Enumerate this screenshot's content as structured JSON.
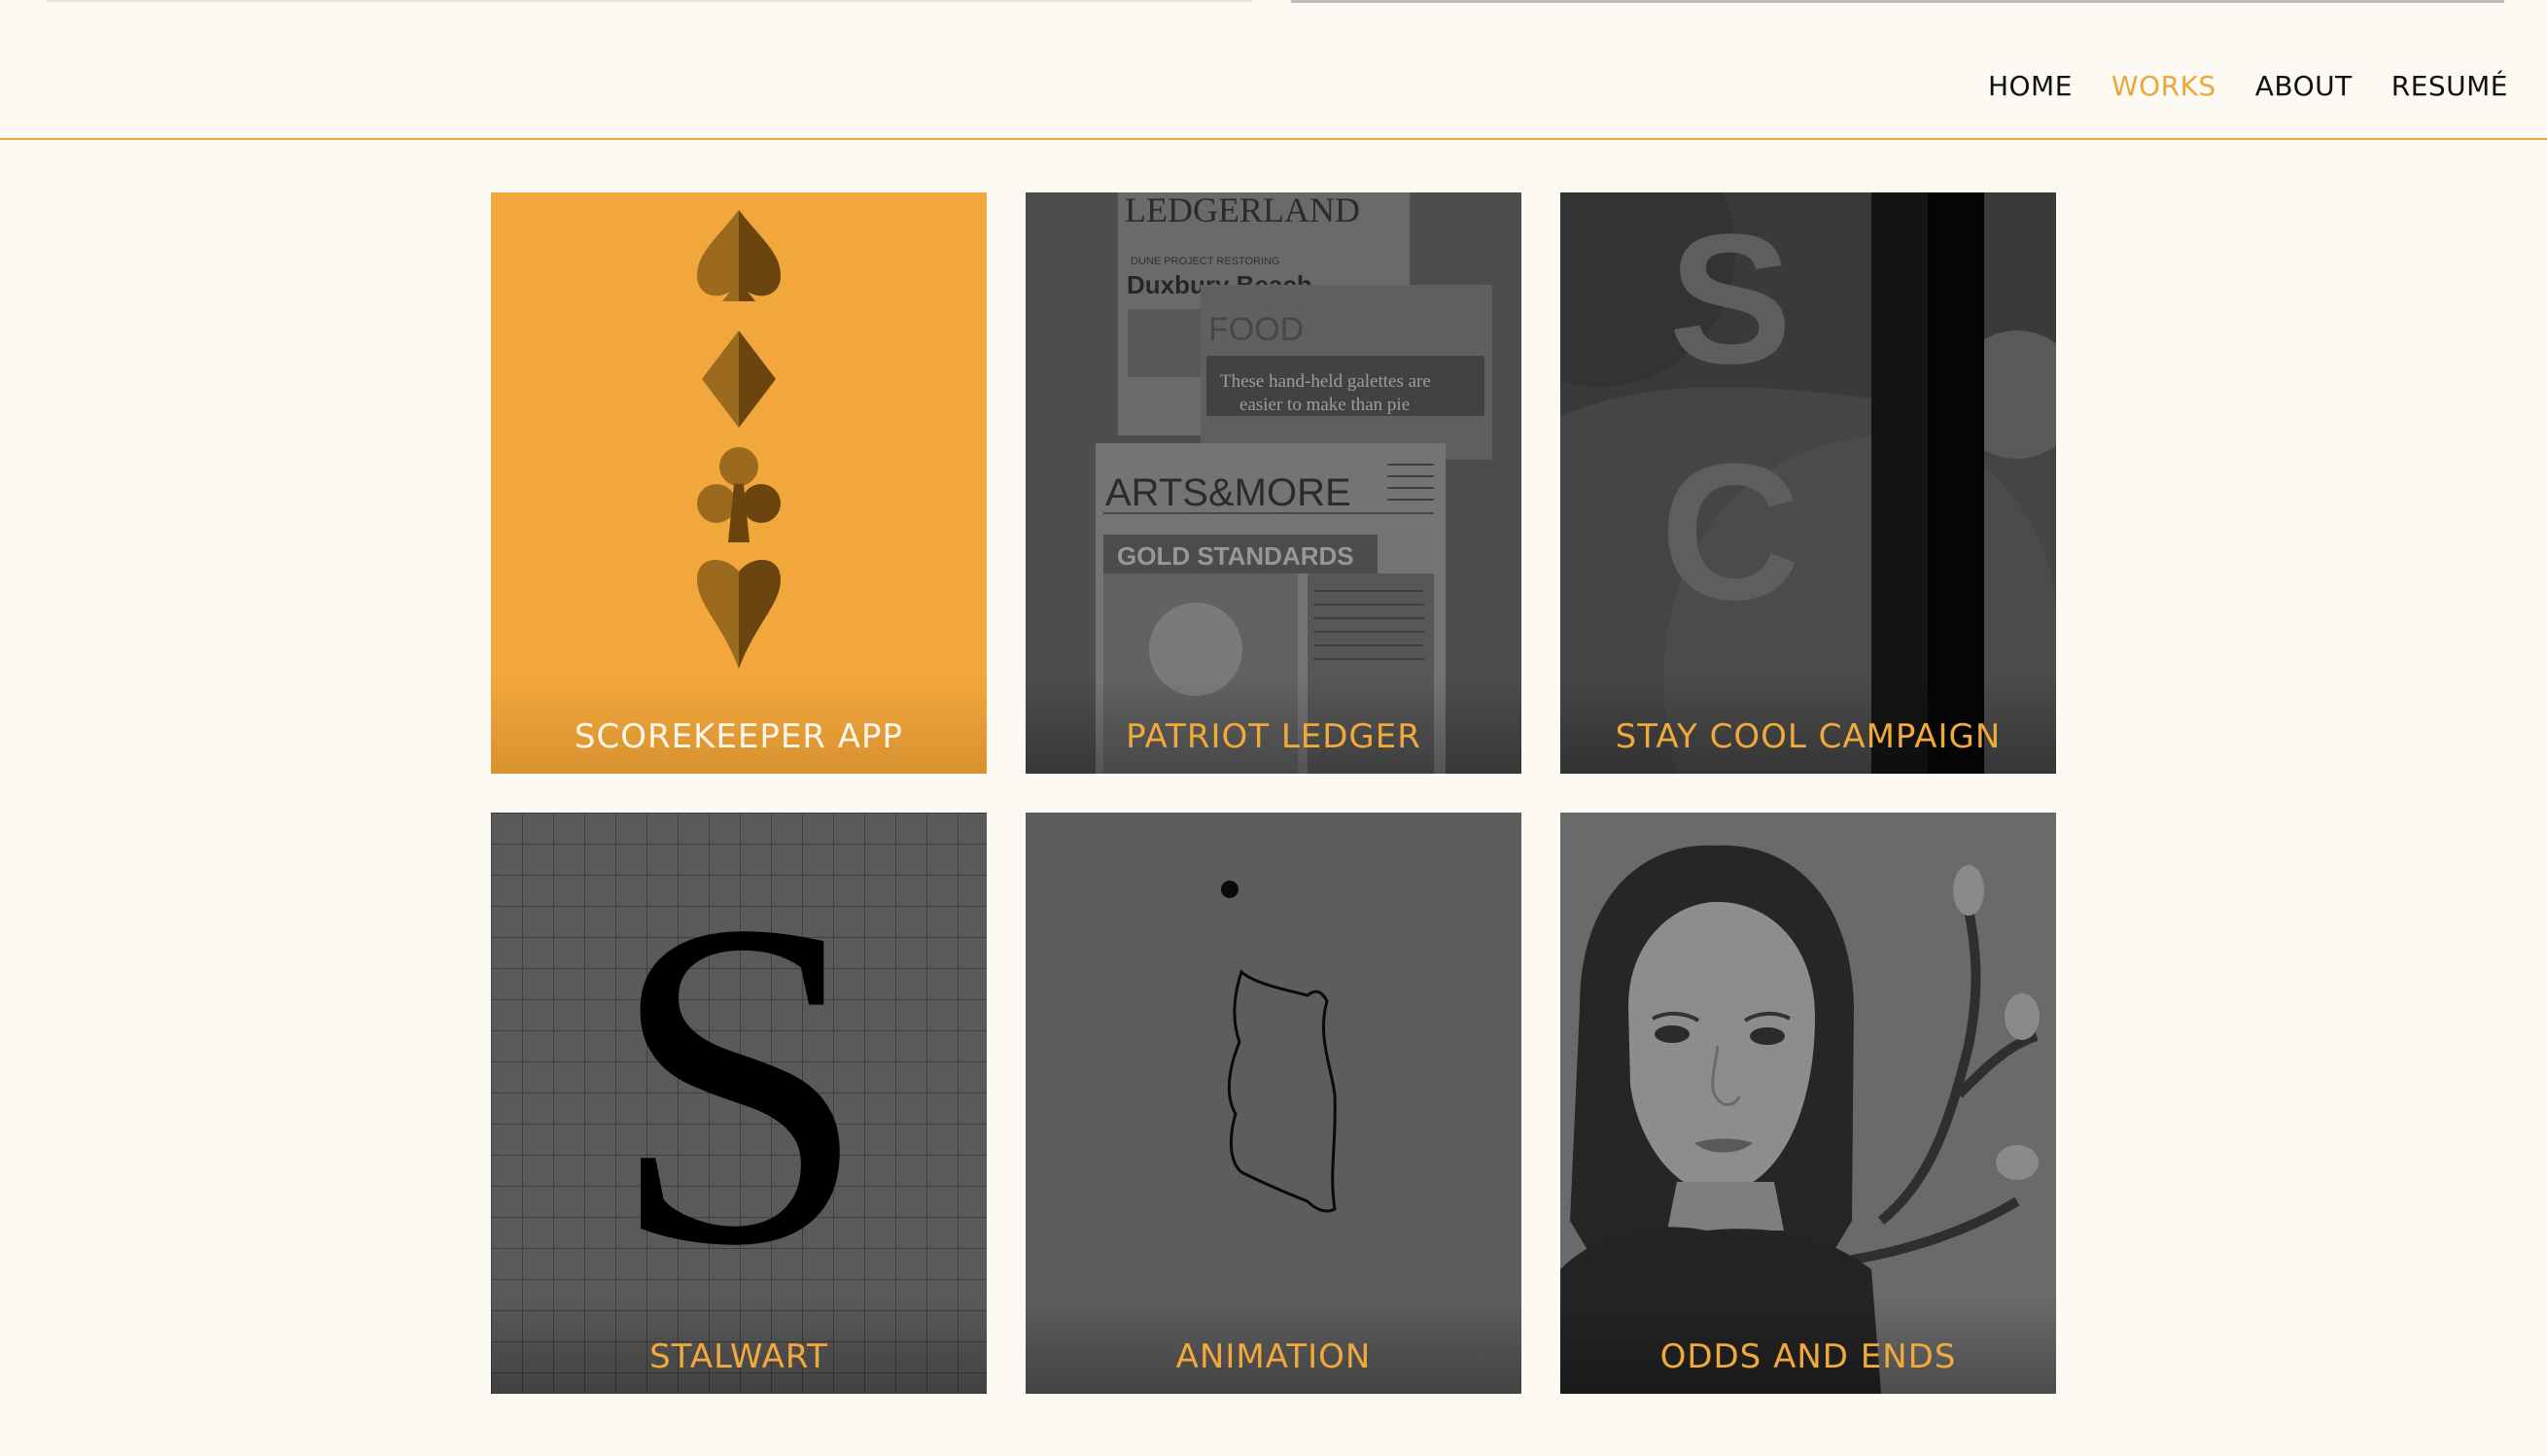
{
  "nav": {
    "items": [
      {
        "label": "HOME"
      },
      {
        "label": "WORKS",
        "active": true
      },
      {
        "label": "ABOUT"
      },
      {
        "label": "RESUMÉ"
      }
    ]
  },
  "works": [
    {
      "title": "SCOREKEEPER APP",
      "background": "#f2a73c"
    },
    {
      "title": "PATRIOT LEDGER",
      "background": "#5d5d5d"
    },
    {
      "title": "STAY COOL CAMPAIGN",
      "background": "#3a3a3a"
    },
    {
      "title": "STALWART",
      "background": "#5a5a5a"
    },
    {
      "title": "ANIMATION",
      "background": "#5d5d5d"
    },
    {
      "title": "ODDS AND ENDS",
      "background": "#666666"
    }
  ],
  "thumbnails": {
    "patriot_ledger": {
      "masthead": "LEDGERLAND",
      "kicker": "DUNE PROJECT RESTORING",
      "headline": "Duxbury Beach",
      "section": "FOOD",
      "subhead_1": "These hand-held galettes are",
      "subhead_2": "easier to make than pie",
      "section_2": "ARTS&MORE",
      "banner": "GOLD STANDARDS"
    },
    "stay_cool": {
      "letter_1": "S",
      "letter_2": "C"
    },
    "stalwart": {
      "letter": "S"
    }
  },
  "colors": {
    "accent": "#e8a93c",
    "background": "#fdf9f3",
    "label_on_orange": "#fdf6ea"
  }
}
